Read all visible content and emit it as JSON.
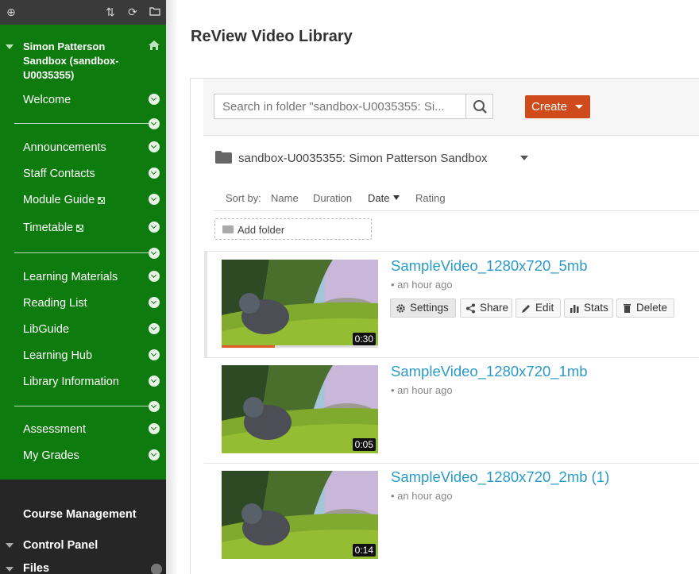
{
  "sidebar": {
    "course_title": "Simon Patterson Sandbox (sandbox-U0035355)",
    "items": [
      {
        "label": "Welcome"
      },
      {
        "label": "Announcements"
      },
      {
        "label": "Staff Contacts"
      },
      {
        "label": "Module Guide"
      },
      {
        "label": "Timetable"
      },
      {
        "label": "Learning Materials"
      },
      {
        "label": "Reading List"
      },
      {
        "label": "LibGuide"
      },
      {
        "label": "Learning Hub"
      },
      {
        "label": "Library Information"
      },
      {
        "label": "Assessment"
      },
      {
        "label": "My Grades"
      }
    ],
    "course_management": "Course Management",
    "control_panel": "Control Panel",
    "files": "Files"
  },
  "main": {
    "title": "ReView Video Library",
    "search": {
      "placeholder": "Search in folder \"sandbox-U0035355: Si..."
    },
    "create_label": "Create",
    "folder_name": "sandbox-U0035355: Simon Patterson Sandbox",
    "sort": {
      "label": "Sort by:",
      "options": [
        "Name",
        "Duration",
        "Date",
        "Rating"
      ],
      "active": "Date"
    },
    "add_folder_label": "Add folder",
    "videos": [
      {
        "title": "SampleVideo_1280x720_5mb",
        "time": "an hour ago",
        "duration": "0:30",
        "progress": 0.34
      },
      {
        "title": "SampleVideo_1280x720_1mb",
        "time": "an hour ago",
        "duration": "0:05"
      },
      {
        "title": "SampleVideo_1280x720_2mb (1)",
        "time": "an hour ago",
        "duration": "0:14"
      }
    ],
    "actions": [
      "Settings",
      "Share",
      "Edit",
      "Stats",
      "Delete"
    ]
  },
  "colors": {
    "sidebar_green": "#0e7b0e",
    "create_button": "#cf4b1b",
    "link_blue": "#2b9ac6"
  }
}
